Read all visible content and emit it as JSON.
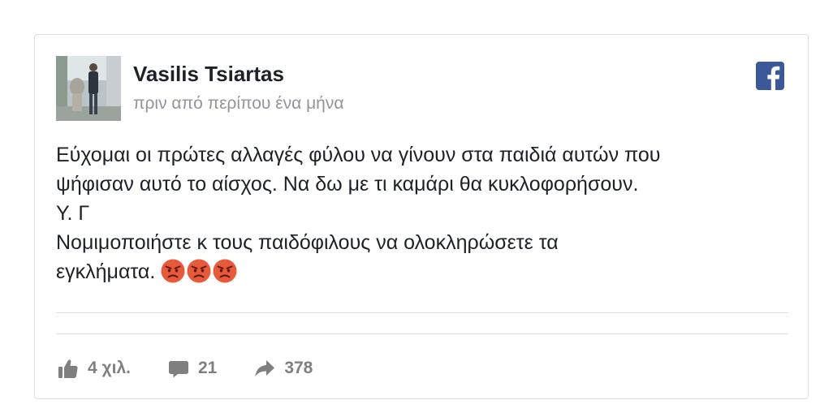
{
  "post": {
    "author": "Vasilis Tsiartas",
    "timestamp": "πριν από περίπου ένα μήνα",
    "lines": [
      "Εύχομαι οι πρώτες αλλαγές φύλου να γίνουν στα παιδιά αυτών που",
      "ψήφισαν αυτό το αίσχος. Να δω με τι καμάρι θα κυκλοφορήσουν.",
      "Υ. Γ",
      "Νομιμοποιήστε κ τους παιδόφιλους να ολοκληρώσετε τα",
      "εγκλήματα."
    ],
    "emojis": [
      "angry-face",
      "angry-face",
      "angry-face"
    ]
  },
  "stats": {
    "likes": "4 χιλ.",
    "comments": "21",
    "shares": "378"
  },
  "icons": {
    "logo": "facebook-icon",
    "like": "thumbs-up-icon",
    "comment": "comment-bubble-icon",
    "share": "share-arrow-icon",
    "emoji": "angry-face-emoji-icon"
  },
  "colors": {
    "facebook_blue": "#3b5998",
    "text_primary": "#1d2129",
    "text_secondary": "#90949c",
    "stat_gray": "#7f7f7f",
    "emoji_red": "#e8593c"
  }
}
